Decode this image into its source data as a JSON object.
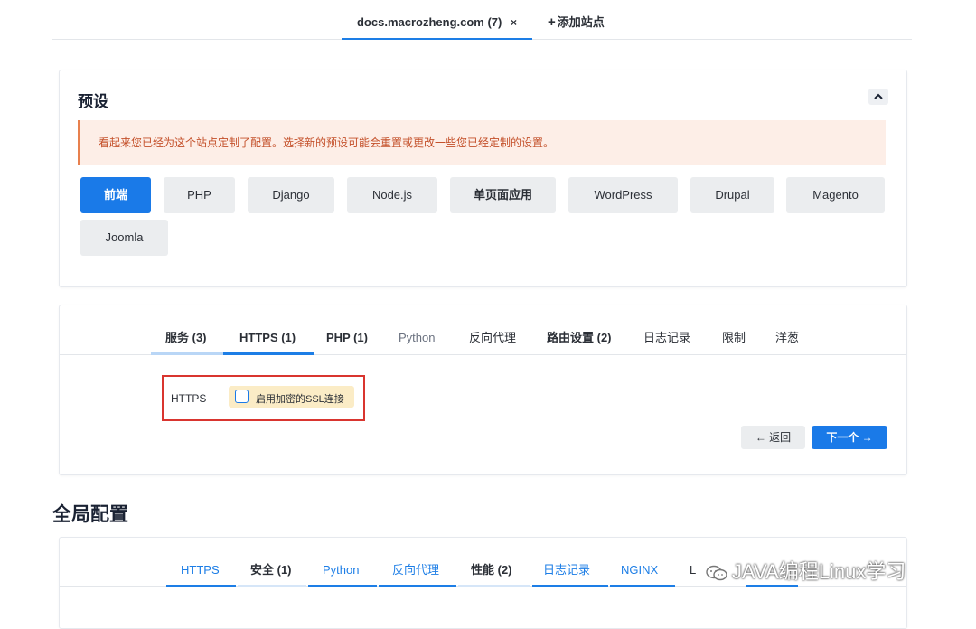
{
  "site_tabs": {
    "active_label": "docs.macrozheng.com (7)",
    "close_glyph": "×",
    "add_label": "添加站点"
  },
  "presets": {
    "title": "预设",
    "warning": "看起来您已经为这个站点定制了配置。选择新的预设可能会重置或更改一些您已经定制的设置。",
    "buttons": [
      "前端",
      "PHP",
      "Django",
      "Node.js",
      "单页面应用",
      "WordPress",
      "Drupal",
      "Magento",
      "Joomla"
    ],
    "active": "前端"
  },
  "domain_tabs": [
    "服务 (3)",
    "HTTPS (1)",
    "PHP (1)",
    "Python",
    "反向代理",
    "路由设置 (2)",
    "日志记录",
    "限制",
    "洋葱"
  ],
  "https_section": {
    "label": "HTTPS",
    "checkbox_label": "启用加密的SSL连接"
  },
  "buttons": {
    "back": "← 返回",
    "next": "下一个 →"
  },
  "global": {
    "title": "全局配置",
    "tabs": [
      "HTTPS",
      "安全 (1)",
      "Python",
      "反向代理",
      "性能 (2)",
      "日志记录",
      "NGINX",
      "L"
    ]
  },
  "watermark": "JAVA编程Linux学习",
  "colors": {
    "accent": "#1a7ae8",
    "warning_bg": "#fdeee7",
    "warning_text": "#c4502a",
    "highlight_border": "#d9352f",
    "checkbox_bg": "#fbecc6"
  }
}
